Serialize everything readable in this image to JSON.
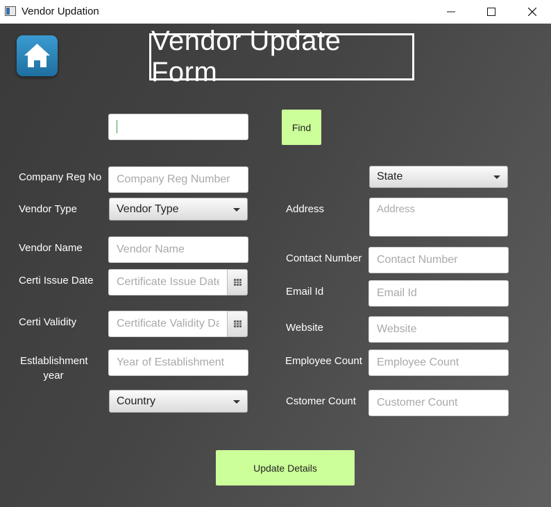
{
  "window": {
    "title": "Vendor Updation",
    "minimize": "—",
    "maximize": "☐",
    "close": "✕"
  },
  "header": {
    "title": "Vendor Update Form"
  },
  "search": {
    "value": "",
    "find_label": "Find"
  },
  "left": {
    "company_reg_label": "Company Reg No",
    "company_reg_placeholder": "Company Reg Number",
    "vendor_type_label": "Vendor Type",
    "vendor_type_value": "Vendor Type",
    "vendor_name_label": "Vendor Name",
    "vendor_name_placeholder": "Vendor Name",
    "certi_issue_label": "Certi Issue Date",
    "certi_issue_placeholder": "Certificate Issue Date",
    "certi_validity_label": "Certi Validity",
    "certi_validity_placeholder": "Certificate Validity Da",
    "establishment_label_line1": "Estlablishment",
    "establishment_label_line2": "year",
    "establishment_placeholder": "Year of Establishment",
    "country_value": "Country"
  },
  "right": {
    "state_value": "State",
    "address_label": "Address",
    "address_placeholder": "Address",
    "contact_label": "Contact Number",
    "contact_placeholder": "Contact Number",
    "email_label": "Email Id",
    "email_placeholder": "Email Id",
    "website_label": "Website",
    "website_placeholder": "Website",
    "employee_label": "Employee Count",
    "employee_placeholder": "Employee Count",
    "customer_label": "Cstomer Count",
    "customer_placeholder": "Customer Count"
  },
  "actions": {
    "update_label": "Update Details"
  },
  "colors": {
    "accent_button": "#ccff99",
    "home_icon_bg": "#2a86bf"
  }
}
